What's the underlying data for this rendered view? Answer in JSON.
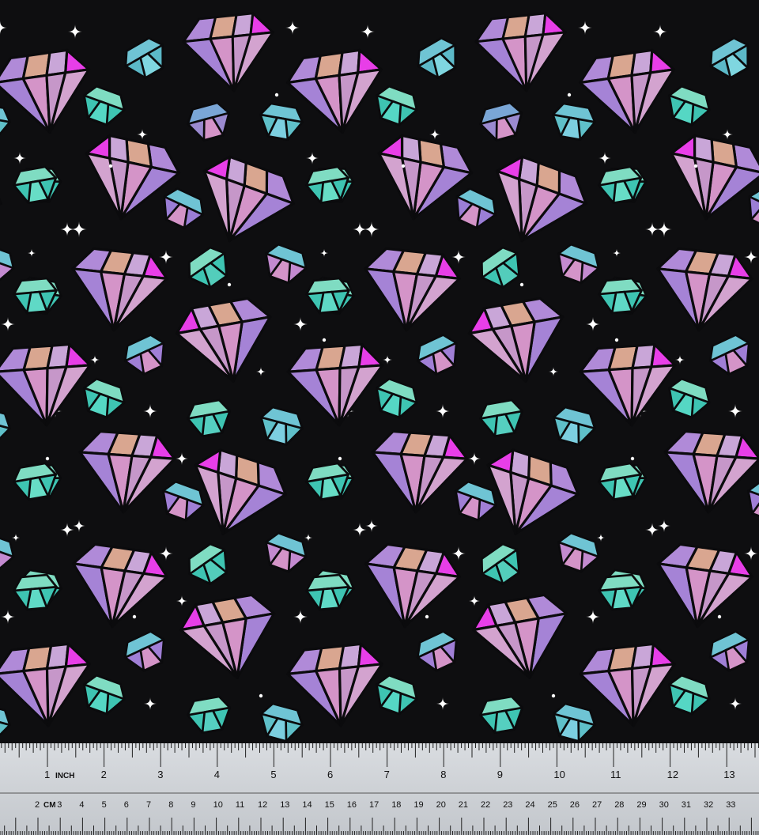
{
  "image": {
    "subject": "fabric-swatch",
    "pattern": "gem-print",
    "background_color": "#0e0e10",
    "palette": {
      "purple": "#b08ad8",
      "pink": "#d494c8",
      "magenta": "#e83ee8",
      "peach": "#d9a690",
      "mint": "#7fdcc2",
      "teal": "#3ec4b2",
      "sky": "#6fc4d4",
      "sparkle": "#ffffff",
      "outline": "#0b0b0d"
    }
  },
  "ruler": {
    "inch_label": "INCH",
    "cm_label": "CM",
    "inch_numbers": [
      "1",
      "2",
      "3",
      "4",
      "5",
      "6",
      "7",
      "8",
      "9",
      "10",
      "11",
      "12",
      "13"
    ],
    "cm_numbers": [
      "2",
      "3",
      "4",
      "5",
      "6",
      "7",
      "8",
      "9",
      "10",
      "11",
      "12",
      "13",
      "14",
      "15",
      "16",
      "17",
      "18",
      "19",
      "20",
      "21",
      "22",
      "23",
      "24",
      "25",
      "26",
      "27",
      "28",
      "29",
      "30",
      "31",
      "32",
      "33"
    ]
  }
}
